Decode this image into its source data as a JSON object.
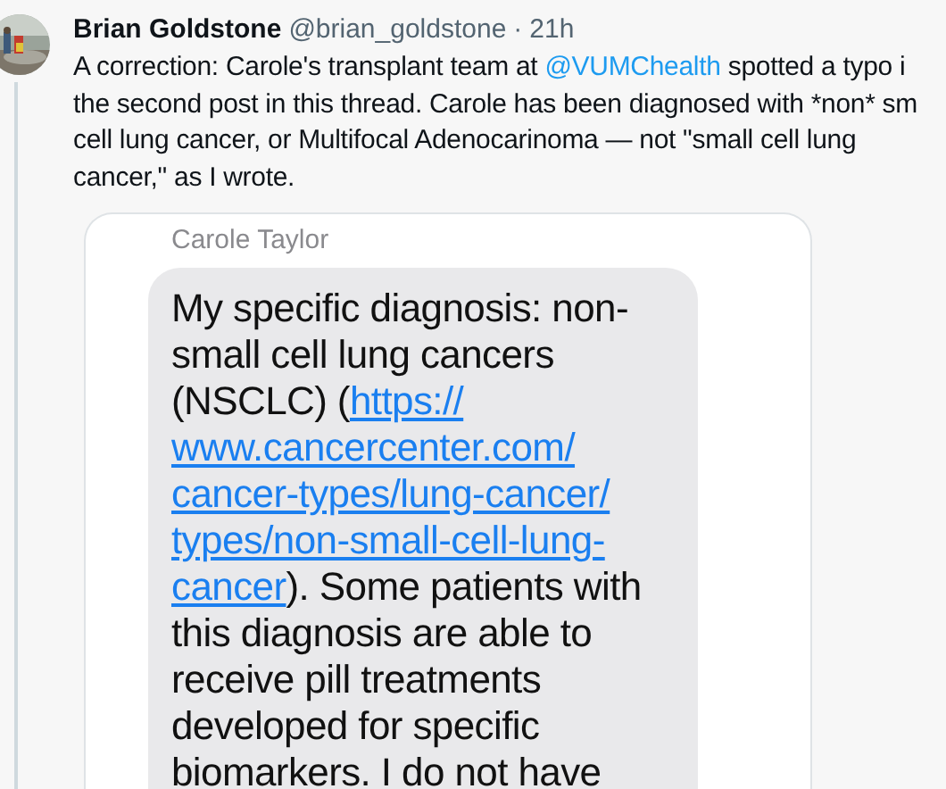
{
  "tweet": {
    "author": "Brian Goldstone",
    "handle": "@brian_goldstone",
    "separator": "·",
    "time": "21h",
    "avatar": {
      "kind": "picture"
    },
    "lines": [
      [
        {
          "kind": "text",
          "text": "A correction: Carole's transplant team at "
        },
        {
          "kind": "mention",
          "text": "@VUMChealth"
        },
        {
          "kind": "text",
          "text": " spotted a typo i"
        }
      ],
      [
        {
          "kind": "text",
          "text": "the second post in this thread. Carole has been diagnosed with *non* sm"
        }
      ],
      [
        {
          "kind": "text",
          "text": "cell lung cancer, or Multifocal Adenocarinoma — not \"small cell lung"
        }
      ],
      [
        {
          "kind": "text",
          "text": "cancer,\" as I wrote."
        }
      ]
    ]
  },
  "screenshot": {
    "sender": "Carole Taylor",
    "lines": [
      [
        {
          "kind": "text",
          "text": "My specific diagnosis: non-"
        }
      ],
      [
        {
          "kind": "text",
          "text": "small cell lung cancers"
        }
      ],
      [
        {
          "kind": "text",
          "text": "(NSCLC) ("
        },
        {
          "kind": "link",
          "text": "https://"
        }
      ],
      [
        {
          "kind": "link",
          "text": "www.cancercenter.com/"
        }
      ],
      [
        {
          "kind": "link",
          "text": "cancer-types/lung-cancer/"
        }
      ],
      [
        {
          "kind": "link",
          "text": "types/non-small-cell-lung-"
        }
      ],
      [
        {
          "kind": "link",
          "text": "cancer"
        },
        {
          "kind": "text",
          "text": "). Some patients with"
        }
      ],
      [
        {
          "kind": "text",
          "text": "this diagnosis are able to"
        }
      ],
      [
        {
          "kind": "text",
          "text": "receive pill treatments"
        }
      ],
      [
        {
          "kind": "text",
          "text": "developed for specific"
        }
      ],
      [
        {
          "kind": "text",
          "text": "biomarkers. I do not have"
        }
      ]
    ]
  }
}
